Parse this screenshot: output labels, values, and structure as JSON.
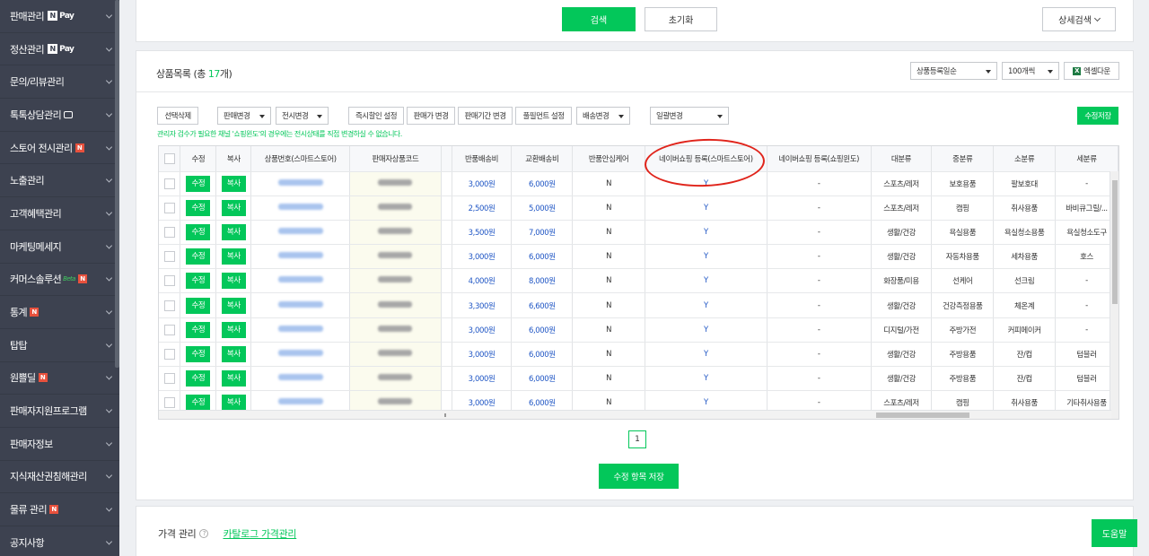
{
  "sidebar": {
    "items": [
      {
        "label": "판매관리",
        "pay": "Pay",
        "badge": ""
      },
      {
        "label": "정산관리",
        "pay": "Pay",
        "badge": ""
      },
      {
        "label": "문의/리뷰관리",
        "pay": "",
        "badge": ""
      },
      {
        "label": "톡톡상담관리",
        "pay": "",
        "badge": "chat"
      },
      {
        "label": "스토어 전시관리",
        "pay": "",
        "badge": "N"
      },
      {
        "label": "노출관리",
        "pay": "",
        "badge": ""
      },
      {
        "label": "고객혜택관리",
        "pay": "",
        "badge": ""
      },
      {
        "label": "마케팅메세지",
        "pay": "",
        "badge": ""
      },
      {
        "label": "커머스솔루션",
        "pay": "",
        "badge": "N",
        "beta": "Beta"
      },
      {
        "label": "통계",
        "pay": "",
        "badge": "N"
      },
      {
        "label": "탑탑",
        "pay": "",
        "badge": ""
      },
      {
        "label": "원쁠딜",
        "pay": "",
        "badge": "N"
      },
      {
        "label": "판매자지원프로그램",
        "pay": "",
        "badge": ""
      },
      {
        "label": "판매자정보",
        "pay": "",
        "badge": ""
      },
      {
        "label": "지식재산권침해관리",
        "pay": "",
        "badge": ""
      },
      {
        "label": "물류 관리",
        "pay": "",
        "badge": "N"
      },
      {
        "label": "공지사항",
        "pay": "",
        "badge": ""
      }
    ],
    "npay_letter": "N",
    "badge_letter": "N"
  },
  "search": {
    "search_label": "검색",
    "reset_label": "초기화",
    "detail_label": "상세검색"
  },
  "list": {
    "title_prefix": "상품목록 (총 ",
    "count": "17",
    "title_suffix": "개)",
    "sort_value": "상품등록일순",
    "page_size_value": "100개씩",
    "excel_label": "엑셀다운",
    "excel_icon_letter": "X"
  },
  "toolbar": {
    "select_delete": "선택삭제",
    "sale_change": "판매변경",
    "display_change": "전시변경",
    "instant_discount": "즉시할인 설정",
    "price_change": "판매가 변경",
    "sale_period_change": "판매기간 변경",
    "fulfillment": "풀필먼트 설정",
    "shipping_change": "배송변경",
    "bulk_change": "일괄변경",
    "save_edit": "수정저장"
  },
  "notice": "관리자 검수가 필요한 채널 '쇼핑윈도'의 경우에는 전시상태를 직접 변경하실 수 없습니다.",
  "grid": {
    "headers": {
      "edit": "수정",
      "copy": "복사",
      "product_no": "상품번호(스마트스토어)",
      "seller_code": "판매자상품코드",
      "return_fee": "반품배송비",
      "exchange_fee": "교환배송비",
      "return_care": "반품안심케어",
      "naver_smart": "네이버쇼핑 등록(스마트스토어)",
      "naver_window": "네이버쇼핑 등록(쇼핑윈도)",
      "cat_large": "대분류",
      "cat_mid": "중분류",
      "cat_small": "소분류",
      "cat_detail": "세분류"
    },
    "edit_btn": "수정",
    "copy_btn": "복사",
    "rows": [
      {
        "return_fee": "3,000원",
        "exchange_fee": "6,000원",
        "care": "N",
        "smart": "Y",
        "window": "-",
        "large": "스포츠/레저",
        "mid": "보호용품",
        "small": "팔보호대",
        "detail": "-"
      },
      {
        "return_fee": "2,500원",
        "exchange_fee": "5,000원",
        "care": "N",
        "smart": "Y",
        "window": "-",
        "large": "스포츠/레저",
        "mid": "캠핑",
        "small": "취사용품",
        "detail": "바비큐그릴/..."
      },
      {
        "return_fee": "3,500원",
        "exchange_fee": "7,000원",
        "care": "N",
        "smart": "Y",
        "window": "-",
        "large": "생활/건강",
        "mid": "욕실용품",
        "small": "욕실청소용품",
        "detail": "욕실청소도구"
      },
      {
        "return_fee": "3,000원",
        "exchange_fee": "6,000원",
        "care": "N",
        "smart": "Y",
        "window": "-",
        "large": "생활/건강",
        "mid": "자동차용품",
        "small": "세차용품",
        "detail": "호스"
      },
      {
        "return_fee": "4,000원",
        "exchange_fee": "8,000원",
        "care": "N",
        "smart": "Y",
        "window": "-",
        "large": "화장품/미용",
        "mid": "선케어",
        "small": "선크림",
        "detail": "-"
      },
      {
        "return_fee": "3,300원",
        "exchange_fee": "6,600원",
        "care": "N",
        "smart": "Y",
        "window": "-",
        "large": "생활/건강",
        "mid": "건강측정용품",
        "small": "체온계",
        "detail": "-"
      },
      {
        "return_fee": "3,000원",
        "exchange_fee": "6,000원",
        "care": "N",
        "smart": "Y",
        "window": "-",
        "large": "디지털/가전",
        "mid": "주방가전",
        "small": "커피메이커",
        "detail": "-"
      },
      {
        "return_fee": "3,000원",
        "exchange_fee": "6,000원",
        "care": "N",
        "smart": "Y",
        "window": "-",
        "large": "생활/건강",
        "mid": "주방용품",
        "small": "잔/컵",
        "detail": "텀블러"
      },
      {
        "return_fee": "3,000원",
        "exchange_fee": "6,000원",
        "care": "N",
        "smart": "Y",
        "window": "-",
        "large": "생활/건강",
        "mid": "주방용품",
        "small": "잔/컵",
        "detail": "텀블러"
      },
      {
        "return_fee": "3,000원",
        "exchange_fee": "6,000원",
        "care": "N",
        "smart": "Y",
        "window": "-",
        "large": "스포츠/레저",
        "mid": "캠핑",
        "small": "취사용품",
        "detail": "기타취사용품"
      }
    ]
  },
  "pagination": {
    "current": "1"
  },
  "save_items_label": "수정 항목 저장",
  "price_section": {
    "title": "가격 관리",
    "info_icon": "?",
    "catalog_link": "카탈로그 가격관리"
  },
  "help_label": "도움말",
  "colors": {
    "accent": "#03c75a",
    "sidebar": "#3d4250",
    "link_blue": "#2157c5",
    "annotation_red": "#e0241b"
  }
}
